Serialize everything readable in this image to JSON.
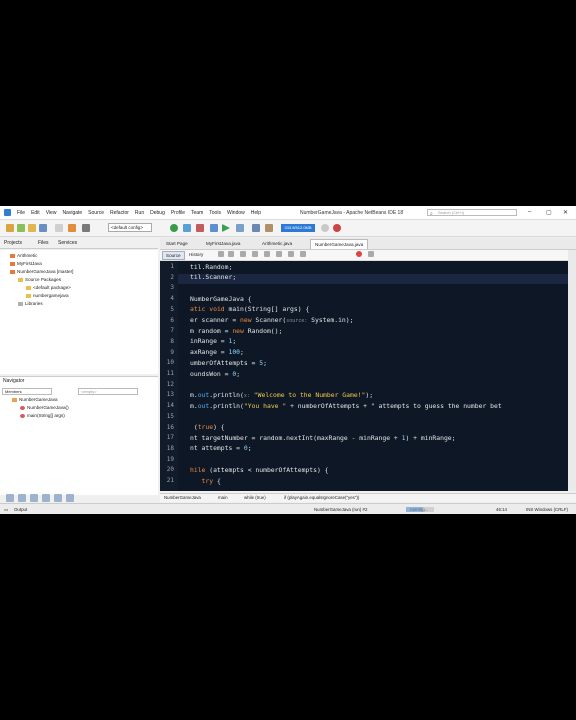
{
  "window": {
    "title": "NumberGameJava - Apache NetBeans IDE 18"
  },
  "menu": [
    "File",
    "Edit",
    "View",
    "Navigate",
    "Source",
    "Refactor",
    "Run",
    "Debug",
    "Profile",
    "Team",
    "Tools",
    "Window",
    "Help"
  ],
  "search": {
    "placeholder": "Search (Ctrl+I)"
  },
  "toolbar": {
    "config": "<default config>",
    "memory": "333.5/512.0MB"
  },
  "projects": {
    "tabs": [
      "Projects",
      "Files",
      "Services"
    ],
    "items": [
      "Arithmetic",
      "MyFirstJava",
      "NumberGameJava [master]",
      "Source Packages",
      "<default package>",
      "numbergamejava",
      "Libraries"
    ]
  },
  "navigator": {
    "tab": "Navigator",
    "filter": "Members",
    "filter2": "<empty>",
    "items": [
      "NumberGameJava",
      "NumberGameJava()",
      "main(String[] args)"
    ]
  },
  "editor": {
    "tabs": [
      "Start Page",
      "MyFirstJava.java",
      "Arithmetic.java",
      "NumberGameJava.java"
    ],
    "src_tabs": [
      "Source",
      "History"
    ],
    "lines": [
      {
        "n": "1",
        "t": "til.Random;"
      },
      {
        "n": "2",
        "t": "til.Scanner;"
      },
      {
        "n": "3",
        "t": ""
      },
      {
        "n": "4",
        "t": "NumberGameJava {"
      },
      {
        "n": "5",
        "t": "atic void main(String[] args) {"
      },
      {
        "n": "6",
        "t": "er scanner = new Scanner(source: System.in);"
      },
      {
        "n": "7",
        "t": "m random = new Random();"
      },
      {
        "n": "8",
        "t": "inRange = 1;"
      },
      {
        "n": "9",
        "t": "axRange = 100;"
      },
      {
        "n": "10",
        "t": "umberOfAttempts = 5;"
      },
      {
        "n": "11",
        "t": "oundsWon = 0;"
      },
      {
        "n": "12",
        "t": ""
      },
      {
        "n": "13",
        "t": "m.out.println(x: \"Welcome to the Number Game!\");"
      },
      {
        "n": "14",
        "t": "m.out.println(\"You have \" + numberOfAttempts + \" attempts to guess the number bet"
      },
      {
        "n": "15",
        "t": ""
      },
      {
        "n": "16",
        "t": " (true) {"
      },
      {
        "n": "17",
        "t": "nt targetNumber = random.nextInt(maxRange - minRange + 1) + minRange;"
      },
      {
        "n": "18",
        "t": "nt attempts = 0;"
      },
      {
        "n": "19",
        "t": ""
      },
      {
        "n": "20",
        "t": "hile (attempts < numberOfAttempts) {"
      },
      {
        "n": "21",
        "t": "   try {"
      }
    ]
  },
  "breadcrumbs": [
    "NumberGameJava",
    "main",
    "while (true)",
    "if (playAgain.equalsIgnoreCase(\"yes\"))"
  ],
  "status": {
    "output": "Output",
    "run": "NumberGameJava (run) #2",
    "running": "running...",
    "progress": 0.6,
    "position": "46:14",
    "mode": "INS Windows (CRLF)"
  }
}
